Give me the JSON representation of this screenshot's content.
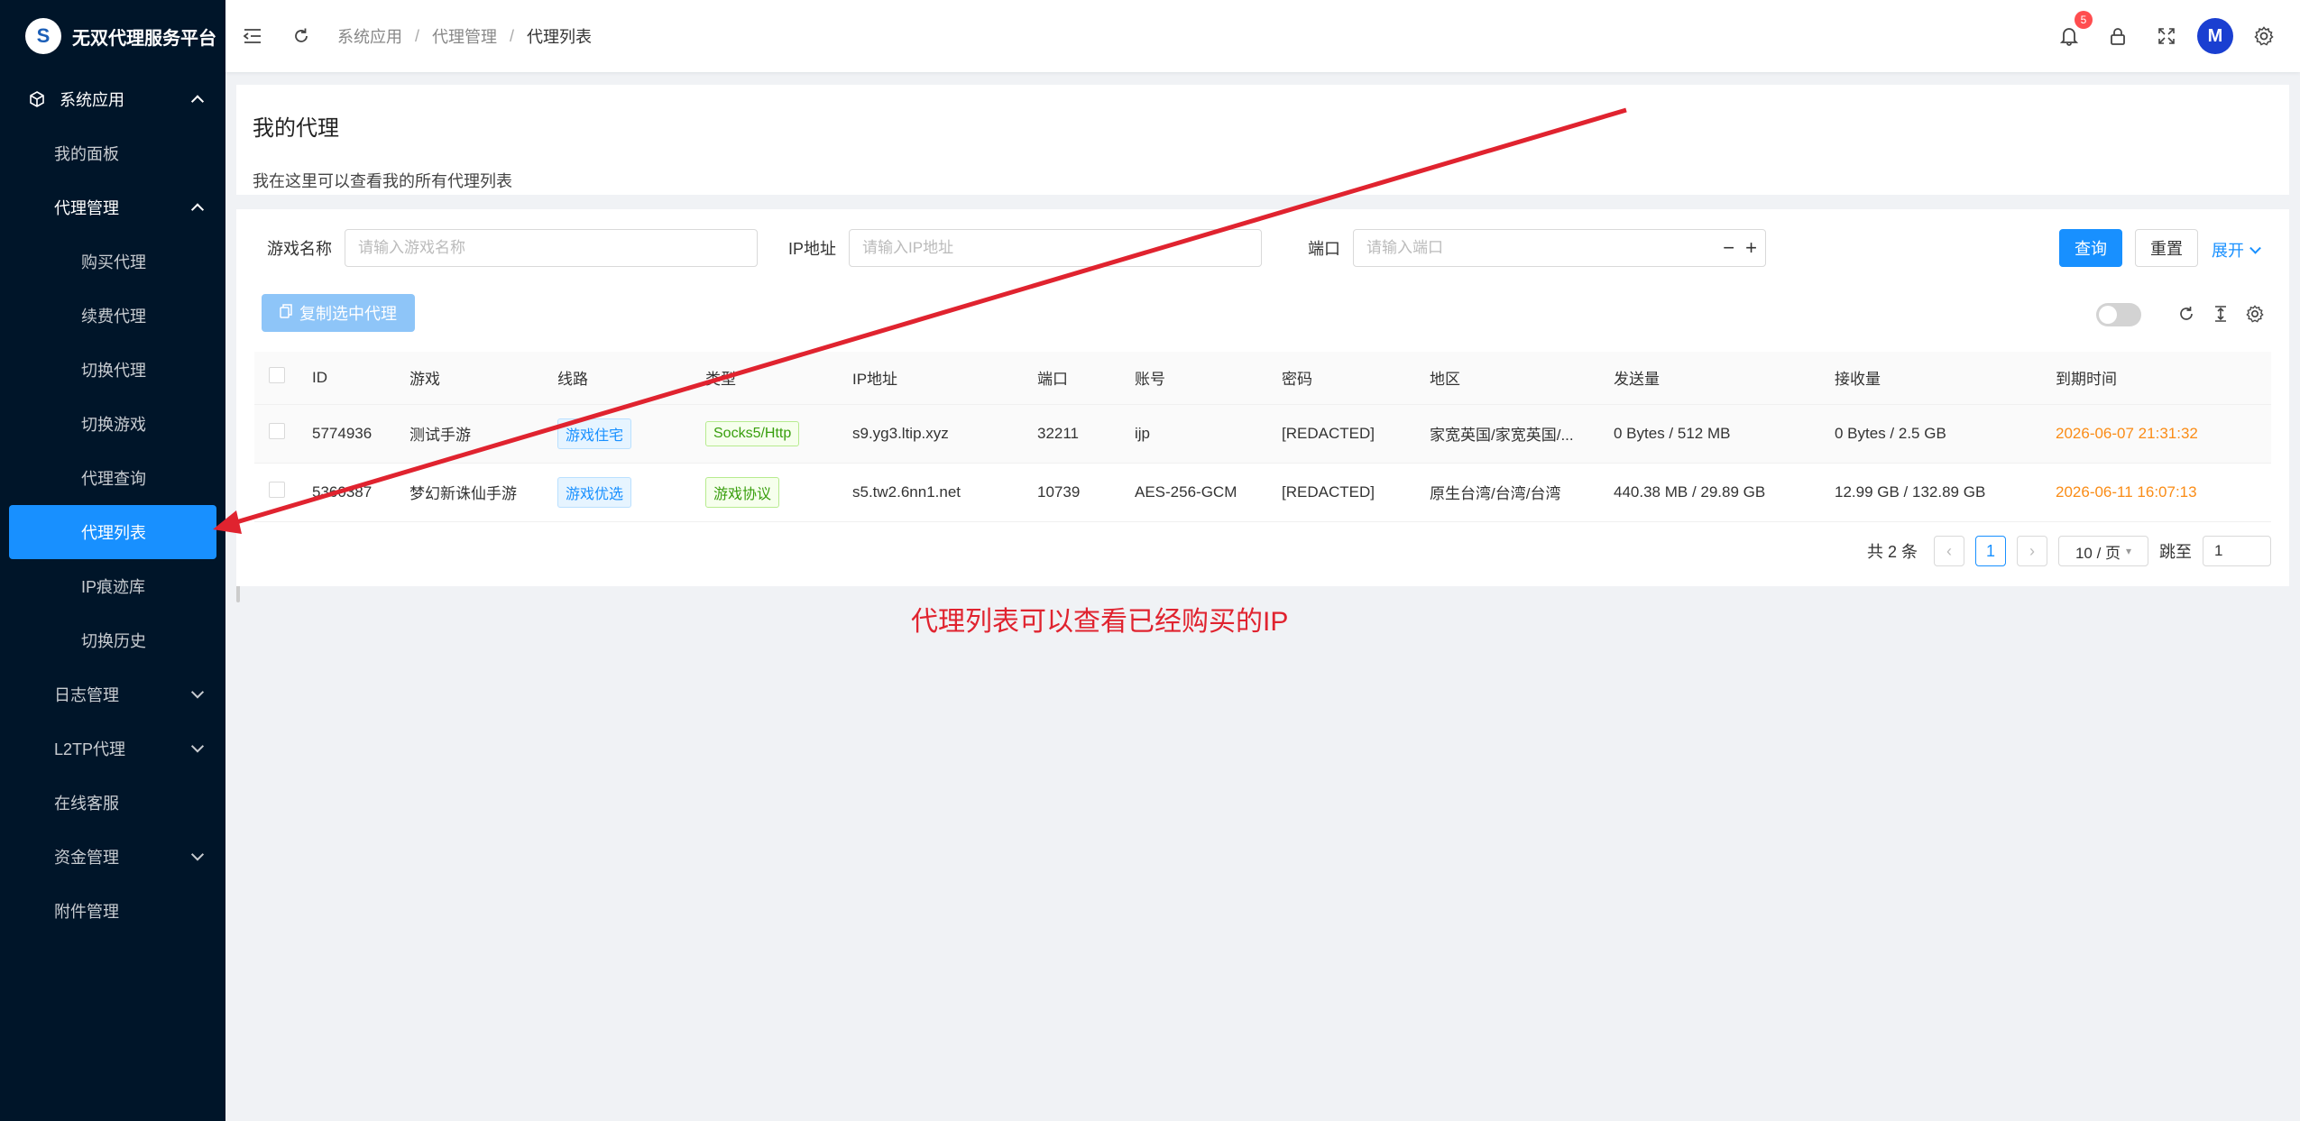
{
  "app": {
    "title": "无双代理服务平台",
    "logo_glyph": "S"
  },
  "sidebar": {
    "section": "系统应用",
    "dashboard": "我的面板",
    "proxy_group": "代理管理",
    "proxy_items": [
      "购买代理",
      "续费代理",
      "切换代理",
      "切换游戏",
      "代理查询",
      "代理列表",
      "IP痕迹库",
      "切换历史"
    ],
    "log_group": "日志管理",
    "l2tp_group": "L2TP代理",
    "support": "在线客服",
    "finance_group": "资金管理",
    "attachments": "附件管理"
  },
  "header": {
    "breadcrumb": [
      "系统应用",
      "代理管理",
      "代理列表"
    ],
    "notification_count": "5",
    "avatar_glyph": "M"
  },
  "page": {
    "title": "我的代理",
    "description": "我在这里可以查看我的所有代理列表"
  },
  "search": {
    "game_label": "游戏名称",
    "game_placeholder": "请输入游戏名称",
    "ip_label": "IP地址",
    "ip_placeholder": "请输入IP地址",
    "port_label": "端口",
    "port_placeholder": "请输入端口",
    "query": "查询",
    "reset": "重置",
    "expand": "展开"
  },
  "toolbar": {
    "copy_selected": "复制选中代理"
  },
  "table": {
    "columns": [
      "ID",
      "游戏",
      "线路",
      "类型",
      "IP地址",
      "端口",
      "账号",
      "密码",
      "地区",
      "发送量",
      "接收量",
      "到期时间"
    ],
    "rows": [
      {
        "id": "5774936",
        "game": "测试手游",
        "line": "游戏住宅",
        "type": "Socks5/Http",
        "ip": "s9.yg3.ltip.xyz",
        "port": "32211",
        "account": "ijp",
        "password": "[REDACTED]",
        "region": "家宽英国/家宽英国/...",
        "sent": "0 Bytes / 512 MB",
        "received": "0 Bytes / 2.5 GB",
        "expires": "2026-06-07 21:31:32"
      },
      {
        "id": "5360387",
        "game": "梦幻新诛仙手游",
        "line": "游戏优选",
        "type": "游戏协议",
        "ip": "s5.tw2.6nn1.net",
        "port": "10739",
        "account": "AES-256-GCM",
        "password": "[REDACTED]",
        "region": "原生台湾/台湾/台湾",
        "sent": "440.38 MB / 29.89 GB",
        "received": "12.99 GB / 132.89 GB",
        "expires": "2026-06-11 16:07:13"
      }
    ]
  },
  "pagination": {
    "total": "共 2 条",
    "current": "1",
    "page_size": "10 / 页",
    "jump_label": "跳至",
    "jump_value": "1"
  },
  "annotation": {
    "text": "代理列表可以查看已经购买的IP",
    "color": "#e0232f"
  },
  "colors": {
    "primary": "#1890ff",
    "sidebar": "#001529",
    "expires": "#fa8c16"
  }
}
